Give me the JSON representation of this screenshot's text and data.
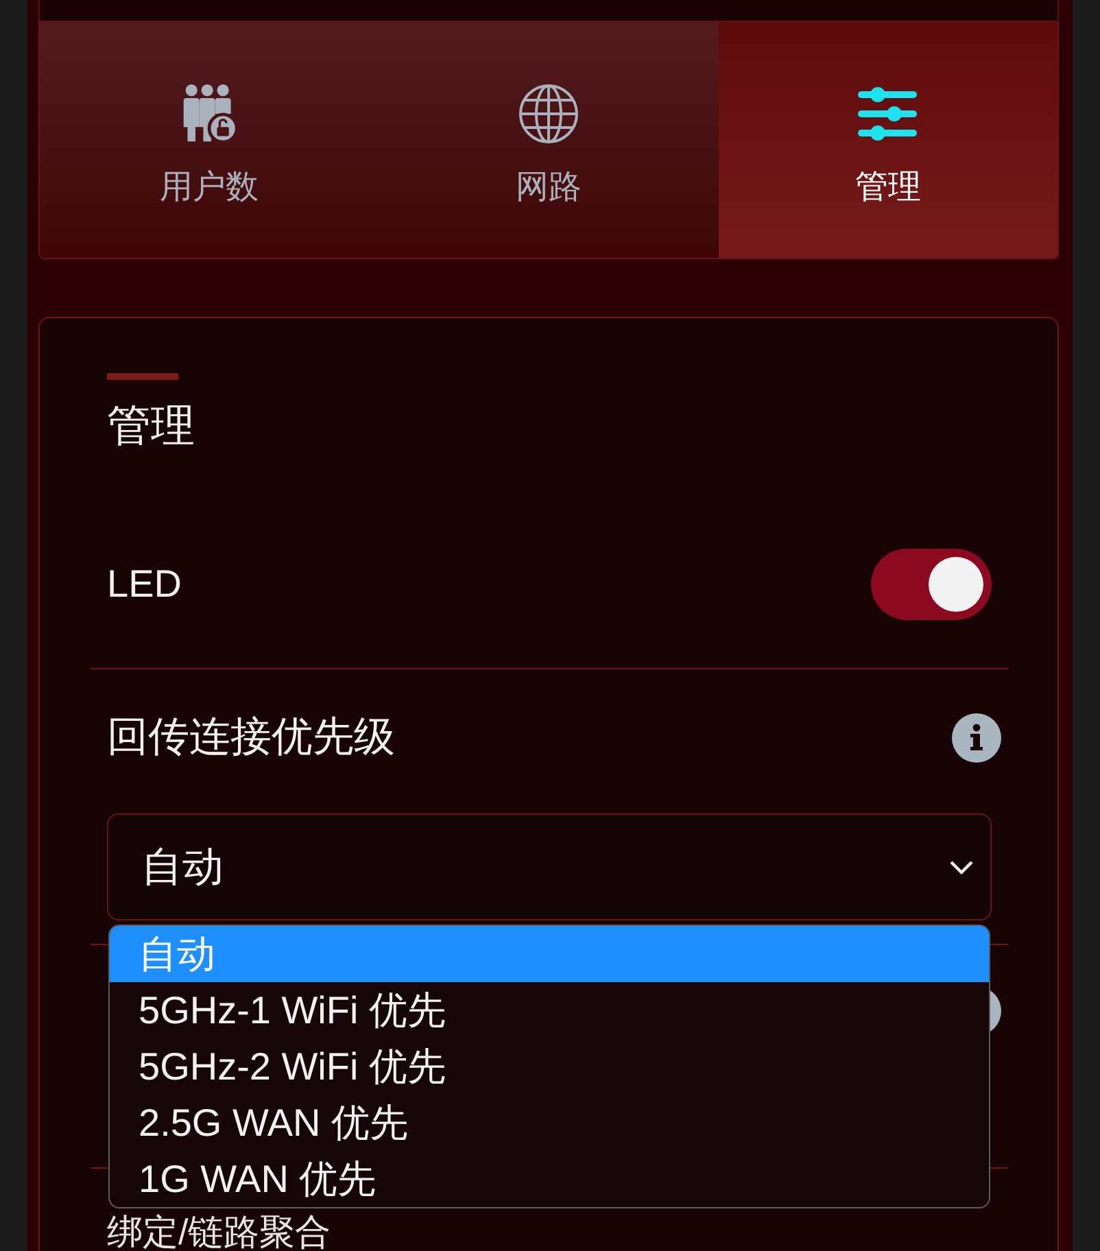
{
  "tabs": [
    {
      "label": "用户数",
      "selected": false
    },
    {
      "label": "网路",
      "selected": false
    },
    {
      "label": "管理",
      "selected": true
    }
  ],
  "section": {
    "title": "管理"
  },
  "settings": [
    {
      "kind": "toggle",
      "label": "LED",
      "on": true
    },
    {
      "kind": "select",
      "label": "回传连接优先级",
      "info": true,
      "value": "自动",
      "expanded": true,
      "options": [
        {
          "label": "自动",
          "selected": true
        },
        {
          "label": "5GHz-1 WiFi 优先",
          "selected": false
        },
        {
          "label": "5GHz-2 WiFi 优先",
          "selected": false
        },
        {
          "label": "2.5G WAN 优先",
          "selected": false
        },
        {
          "label": "1G WAN 优先",
          "selected": false
        }
      ]
    },
    {
      "kind": "covered",
      "info": true
    },
    {
      "kind": "text",
      "label": "绑定/链路聚合"
    }
  ]
}
